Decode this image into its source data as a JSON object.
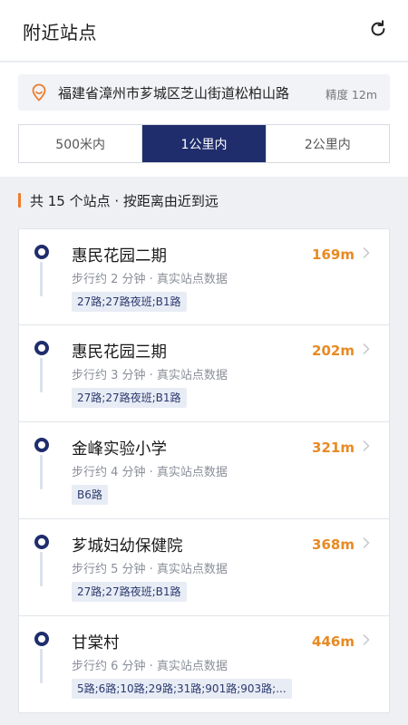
{
  "header": {
    "title": "附近站点",
    "refresh_icon": "refresh-icon"
  },
  "location": {
    "address": "福建省漳州市芗城区芝山街道松柏山路",
    "accuracy": "精度 12m",
    "icon": "location-pin-icon"
  },
  "tabs": [
    {
      "label": "500米内",
      "active": false
    },
    {
      "label": "1公里内",
      "active": true
    },
    {
      "label": "2公里内",
      "active": false
    }
  ],
  "summary": "共 15 个站点 · 按距离由近到远",
  "colors": {
    "accent": "#1f2d6c",
    "distance": "#e88a23",
    "bar": "#f07a28"
  },
  "stations": [
    {
      "name": "惠民花园二期",
      "walk": "步行约 2 分钟 · 真实站点数据",
      "routes": "27路;27路夜班;B1路",
      "distance": "169m"
    },
    {
      "name": "惠民花园三期",
      "walk": "步行约 3 分钟 · 真实站点数据",
      "routes": "27路;27路夜班;B1路",
      "distance": "202m"
    },
    {
      "name": "金峰实验小学",
      "walk": "步行约 4 分钟 · 真实站点数据",
      "routes": "B6路",
      "distance": "321m"
    },
    {
      "name": "芗城妇幼保健院",
      "walk": "步行约 5 分钟 · 真实站点数据",
      "routes": "27路;27路夜班;B1路",
      "distance": "368m"
    },
    {
      "name": "甘棠村",
      "walk": "步行约 6 分钟 · 真实站点数据",
      "routes": "5路;6路;10路;29路;31路;901路;903路;...",
      "distance": "446m"
    }
  ]
}
